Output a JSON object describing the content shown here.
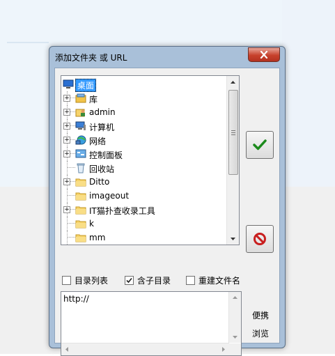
{
  "dialog": {
    "title": "添加文件夹 或 URL",
    "close_icon": "close-icon",
    "tree": {
      "root": {
        "label": "桌面",
        "icon": "desktop-icon"
      },
      "items": [
        {
          "label": "库",
          "icon": "library-icon",
          "expandable": true
        },
        {
          "label": "admin",
          "icon": "user-folder-icon",
          "expandable": true
        },
        {
          "label": "计算机",
          "icon": "computer-icon",
          "expandable": true
        },
        {
          "label": "网络",
          "icon": "network-icon",
          "expandable": true
        },
        {
          "label": "控制面板",
          "icon": "control-panel-icon",
          "expandable": true
        },
        {
          "label": "回收站",
          "icon": "recycle-bin-icon",
          "expandable": false
        },
        {
          "label": "Ditto",
          "icon": "folder-icon",
          "expandable": true
        },
        {
          "label": "imageout",
          "icon": "folder-icon",
          "expandable": false
        },
        {
          "label": "IT猫扑查收录工具",
          "icon": "folder-icon",
          "expandable": true
        },
        {
          "label": "k",
          "icon": "folder-icon",
          "expandable": false
        },
        {
          "label": "mm",
          "icon": "folder-icon",
          "expandable": false
        }
      ]
    },
    "options": {
      "dir_list": {
        "label": "目录列表",
        "checked": false
      },
      "include_sub": {
        "label": "含子目录",
        "checked": true
      },
      "rebuild_name": {
        "label": "重建文件名",
        "checked": false
      }
    },
    "url_field": {
      "value": "http://"
    },
    "ok_icon": "checkmark-icon",
    "cancel_icon": "no-entry-icon",
    "portable_label": "便携",
    "browse_label": "浏览"
  },
  "colors": {
    "frame": "#a9c0d9",
    "close": "#c7412c",
    "selection": "#3399ff",
    "check_green": "#1c8a1c",
    "cancel_red": "#c81e1e"
  }
}
